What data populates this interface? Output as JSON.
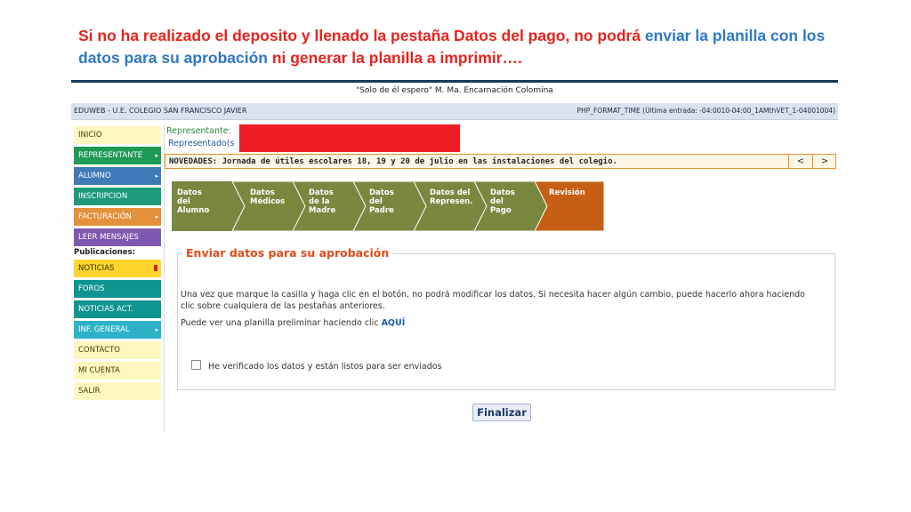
{
  "caption": {
    "part1": "Si no ha realizado el deposito y llenado la pestaña Datos del pago, no podrá ",
    "part2": "enviar",
    "part3": " la ",
    "part4": "planilla con los datos para su aprobación",
    "part5": " ni generar la planilla a imprimir….",
    "color_red": "#e8231f",
    "color_blue": "#2f78c5"
  },
  "header": {
    "motto": "\"Solo de él espero\" M. Ma. Encarnación Colomina",
    "school": "EDUWEB - U.E. COLEGIO SAN FRANCISCO JAVIER",
    "last_entry": "PHP_FORMAT_TIME (Última entrada: -04:0010-04:00_1AMthVET_1-04001004)"
  },
  "sidebar": {
    "items": [
      {
        "label": "INICIO",
        "color": "yellow",
        "submenu": false
      },
      {
        "label": "REPRESENTANTE",
        "color": "green",
        "submenu": true
      },
      {
        "label": "ALUMNO",
        "color": "blue",
        "submenu": true
      },
      {
        "label": "INSCRIPCION",
        "color": "teal",
        "submenu": false
      },
      {
        "label": "FACTURACIÓN",
        "color": "orange",
        "submenu": true
      },
      {
        "label": "LEER MENSAJES",
        "color": "purple",
        "submenu": false
      }
    ],
    "publications_label": "Publicaciones:",
    "items2": [
      {
        "label": "NOTICIAS",
        "color": "yellow2",
        "badge": true
      },
      {
        "label": "FOROS",
        "color": "tealdark"
      },
      {
        "label": "NOTICIAS ACT.",
        "color": "tealdark"
      },
      {
        "label": "INF. GENERAL",
        "color": "cyan",
        "submenu": true
      },
      {
        "label": "CONTACTO",
        "color": "yellow"
      },
      {
        "label": "MI CUENTA",
        "color": "yellow"
      },
      {
        "label": "SALIR",
        "color": "yellow"
      }
    ]
  },
  "main": {
    "representante_label": "Representante:",
    "representado_label": "Representado(s",
    "news_text": "NOVEDADES: Jornada de útiles escolares 18, 19 y 20 de julio en las instalaciones del colegio.",
    "prev_btn": "<",
    "next_btn": ">",
    "steps": [
      {
        "label": "Datos del\nAlumno",
        "active": false
      },
      {
        "label": "Datos\nMédicos",
        "active": false
      },
      {
        "label": "Datos de la\nMadre",
        "active": false
      },
      {
        "label": "Datos del\nPadre",
        "active": false
      },
      {
        "label": "Datos del\nRepresen.",
        "active": false
      },
      {
        "label": "Datos del\nPago",
        "active": false
      },
      {
        "label": "Revisión",
        "active": true
      }
    ],
    "step_color": "#7a873f",
    "step_active_color": "#c55f15",
    "legend": "Enviar datos para su aprobación",
    "paragraph": "Una vez que marque la casilla y haga clic en el botón, no podrá modificar los datos. Si necesita hacer algún cambio, puede hacerlo ahora haciendo clic sobre cualquiera de las pestañas anteriores.",
    "preview_text": "Puede ver una planilla preliminar haciendo clic ",
    "preview_link": "AQUÍ",
    "checkbox_label": "He verificado los datos y están listos para ser enviados",
    "finalize_button": "Finalizar"
  }
}
